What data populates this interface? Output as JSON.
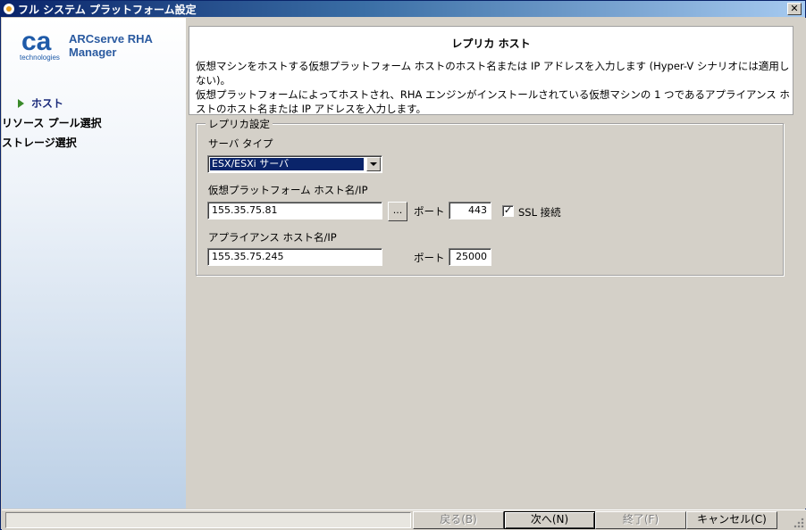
{
  "window": {
    "title": "フル システム プラットフォーム設定",
    "close_glyph": "✕"
  },
  "brand": {
    "logo_text": "ca",
    "logo_sub": "technologies",
    "product_line1": "ARCserve RHA",
    "product_line2": "Manager",
    "logo_color": "#1e5aa8"
  },
  "sidebar": {
    "items": [
      {
        "label": "ホスト",
        "active": true
      },
      {
        "label": "リソース プール選択",
        "active": false
      },
      {
        "label": "ストレージ選択",
        "active": false
      }
    ]
  },
  "header": {
    "title": "レプリカ ホスト",
    "desc_line1": "仮想マシンをホストする仮想プラットフォーム ホストのホスト名または IP アドレスを入力します (Hyper-V シナリオには適用しない)。",
    "desc_line2": "仮想プラットフォームによってホストされ、RHA エンジンがインストールされている仮想マシンの 1 つであるアプライアンス ホストのホスト名または IP アドレスを入力します。"
  },
  "replica_settings": {
    "legend": "レプリカ設定",
    "server_type_label": "サーバ タイプ",
    "server_type_value": "ESX/ESXi サーバ",
    "platform_host_label": "仮想プラットフォーム ホスト名/IP",
    "platform_host_value": "155.35.75.81",
    "browse_label": "...",
    "platform_port_label": "ポート",
    "platform_port_value": "443",
    "ssl_checked_glyph": "✓",
    "ssl_label": "SSL 接続",
    "appliance_host_label": "アプライアンス ホスト名/IP",
    "appliance_host_value": "155.35.75.245",
    "appliance_port_label": "ポート",
    "appliance_port_value": "25000"
  },
  "buttons": {
    "back": "戻る(B)",
    "next": "次へ(N)",
    "finish": "終了(F)",
    "cancel": "キャンセル(C)"
  }
}
